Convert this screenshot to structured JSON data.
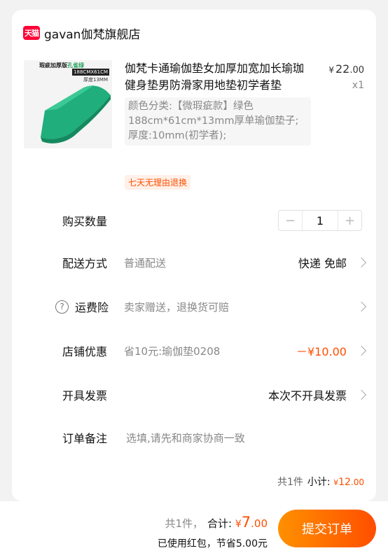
{
  "shop": {
    "logo_text": "天猫",
    "name": "gavan伽梵旗舰店",
    "brand_color": "#ff0036"
  },
  "product": {
    "image_text_1": "瑕疵加厚版",
    "image_text_1b": "孔雀绿",
    "image_text_2": "188CMX61CM",
    "image_text_3": "厚度13MM",
    "image_color": "#1fae7c",
    "title": "伽梵卡通瑜伽垫女加厚加宽加长瑜珈健身垫男防滑家用地垫初学者垫",
    "price_symbol": "¥",
    "price_int": "22",
    "price_dec": ".00",
    "quantity_text": "x1",
    "sku": "颜色分类:【微瑕疵款】绿色188cm*61cm*13mm厚单瑜伽垫子;厚度:10mm(初学者);",
    "badge": "七天无理由退换"
  },
  "rows": {
    "quantity": {
      "label": "购买数量",
      "value": "1",
      "minus": "−",
      "plus": "+"
    },
    "delivery": {
      "label": "配送方式",
      "value": "普通配送",
      "right": "快递 免邮"
    },
    "insurance": {
      "help": "?",
      "label": "运费险",
      "value": "卖家赠送，退换货可赔"
    },
    "discount": {
      "label": "店铺优惠",
      "value": "省10元:瑜伽垫0208",
      "right": "－¥10.00"
    },
    "invoice": {
      "label": "开具发票",
      "right": "本次不开具发票"
    },
    "note": {
      "label": "订单备注",
      "placeholder": "选填,请先和商家协商一致"
    }
  },
  "subtotal": {
    "count": "共1件",
    "label": "小计:",
    "symbol": "¥",
    "int": "12",
    "dec": ".00"
  },
  "footer": {
    "count": "共1件，",
    "label": "合计:",
    "symbol": "¥",
    "int": "7",
    "dec": ".00",
    "saving": "已使用红包，节省5.00元",
    "submit": "提交订单",
    "accent": "#ff4e00"
  }
}
